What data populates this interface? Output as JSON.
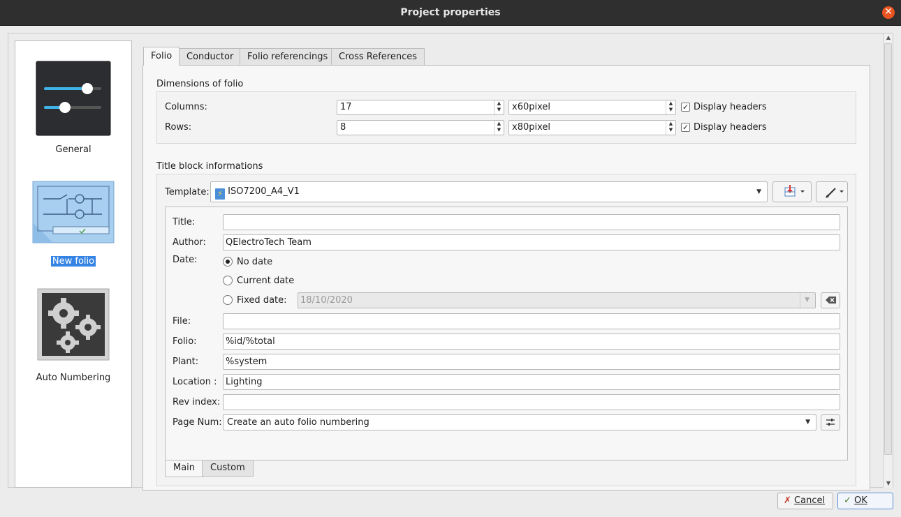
{
  "window": {
    "title": "Project properties"
  },
  "categories": [
    {
      "label": "General",
      "icon": "sliders-icon"
    },
    {
      "label": "New folio",
      "icon": "folio-icon"
    },
    {
      "label": "Auto Numbering",
      "icon": "gears-icon"
    }
  ],
  "tabs": [
    "Folio",
    "Conductor",
    "Folio referencings",
    "Cross References"
  ],
  "dimensions": {
    "title": "Dimensions of folio",
    "columns_label": "Columns:",
    "columns_value": "17",
    "columns_unit": "x60pixel",
    "rows_label": "Rows:",
    "rows_value": "8",
    "rows_unit": "x80pixel",
    "display_headers_label": "Display headers",
    "columns_headers_checked": true,
    "rows_headers_checked": true
  },
  "titleblock": {
    "title": "Title block informations",
    "template_label": "Template:",
    "template_value": "ISO7200_A4_V1",
    "fields": {
      "title_label": "Title:",
      "title_value": "",
      "author_label": "Author:",
      "author_value": "QElectroTech Team",
      "date_label": "Date:",
      "no_date_label": "No date",
      "current_date_label": "Current date",
      "fixed_date_label": "Fixed date:",
      "fixed_date_value": "18/10/2020",
      "selected_date_option": "No date",
      "file_label": "File:",
      "file_value": "",
      "folio_label": "Folio:",
      "folio_value": "%id/%total",
      "plant_label": "Plant:",
      "plant_value": "%system",
      "location_label": "Location :",
      "location_value": "Lighting",
      "rev_label": "Rev index:",
      "rev_value": "",
      "pagenum_label": "Page Num:",
      "pagenum_value": "Create an auto folio numbering"
    },
    "bottom_tabs": [
      "Main",
      "Custom"
    ]
  },
  "buttons": {
    "cancel": "Cancel",
    "ok": "OK"
  },
  "colors": {
    "titlebar": "#2f2f2f",
    "close": "#e95420",
    "selection": "#3584e4"
  }
}
